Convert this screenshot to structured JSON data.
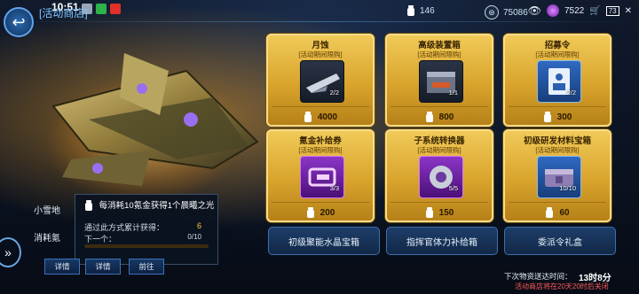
{
  "status_bar": {
    "time": "10:51",
    "right_text": "10.7 44 K/s",
    "battery": "73"
  },
  "header": {
    "title": "[活动商店]"
  },
  "currencies": [
    {
      "icon": "keg-icon",
      "value": "146"
    },
    {
      "icon": "coin-icon",
      "value": "75086"
    },
    {
      "icon": "crystal-icon",
      "value": "7522"
    }
  ],
  "items": [
    {
      "name": "月蚀",
      "sub": "[活动期间限购]",
      "count": "2/2",
      "price": "4000",
      "icon": "ship-part-icon",
      "style": "dark"
    },
    {
      "name": "高级装置箱",
      "sub": "[活动期间限购]",
      "count": "1/1",
      "price": "800",
      "icon": "device-box-icon",
      "style": "dark"
    },
    {
      "name": "招募令",
      "sub": "[活动期间限购]",
      "count": "2/2",
      "price": "300",
      "icon": "recruit-order-icon",
      "style": "blue"
    },
    {
      "name": "氪金补给券",
      "sub": "[活动期间限购]",
      "count": "3/3",
      "price": "200",
      "icon": "voucher-icon",
      "style": "purple"
    },
    {
      "name": "子系统转换器",
      "sub": "[活动期间限购]",
      "count": "5/5",
      "price": "150",
      "icon": "converter-icon",
      "style": "purple"
    },
    {
      "name": "初级研发材料宝箱",
      "sub": "[活动期间限购]",
      "count": "10/10",
      "price": "60",
      "icon": "material-chest-icon",
      "style": "blue"
    }
  ],
  "bottom_items": [
    "初级聚能水晶宝箱",
    "指挥官体力补给箱",
    "委派令礼盒"
  ],
  "popup": {
    "header": "每消耗10氪金获得1个晨曦之光",
    "line1_label": "通过此方式累计获得：",
    "line1_value": "6",
    "line2_label": "下一个：",
    "line2_value": "0/10",
    "progress": 0.0
  },
  "left_panel": {
    "title": "小雪地",
    "line": "消耗氪"
  },
  "buttons": {
    "detail": "详情",
    "detail2": "详情",
    "goto": "前往"
  },
  "footer": {
    "refresh_label": "下次物资送达时间：",
    "refresh_value": "13时8分",
    "closing_note": "活动商店将在20天20时后关闭"
  }
}
